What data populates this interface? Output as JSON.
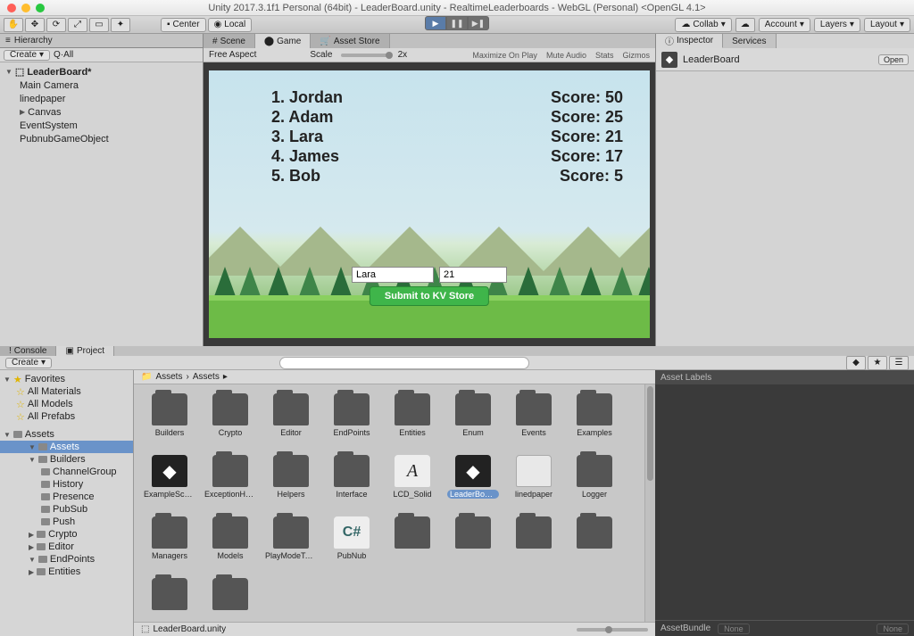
{
  "window": {
    "title": "Unity 2017.3.1f1 Personal (64bit) - LeaderBoard.unity - RealtimeLeaderboards - WebGL (Personal) <OpenGL 4.1>"
  },
  "toolbar": {
    "center": "Center",
    "local": "Local",
    "collab": "Collab",
    "account": "Account",
    "layers": "Layers",
    "layout": "Layout"
  },
  "hierarchy": {
    "tab": "Hierarchy",
    "create": "Create",
    "all_filter": "Q·All",
    "scene_name": "LeaderBoard*",
    "items": [
      "Main Camera",
      "linedpaper",
      "Canvas",
      "EventSystem",
      "PubnubGameObject"
    ]
  },
  "center_tabs": {
    "scene": "Scene",
    "game": "Game",
    "asset_store": "Asset Store"
  },
  "game_bar": {
    "aspect": "Free Aspect",
    "scale_label": "Scale",
    "scale_value": "2x",
    "opts": [
      "Maximize On Play",
      "Mute Audio",
      "Stats",
      "Gizmos"
    ]
  },
  "leaderboard": {
    "rows": [
      {
        "rank": "1.",
        "name": "Jordan",
        "score_label": "Score:",
        "score": "50"
      },
      {
        "rank": "2.",
        "name": "Adam",
        "score_label": "Score:",
        "score": "25"
      },
      {
        "rank": "3.",
        "name": "Lara",
        "score_label": "Score:",
        "score": "21"
      },
      {
        "rank": "4.",
        "name": "James",
        "score_label": "Score:",
        "score": "17"
      },
      {
        "rank": "5.",
        "name": "Bob",
        "score_label": "Score:",
        "score": "5"
      }
    ],
    "input_name": "Lara",
    "input_score": "21",
    "submit": "Submit to KV Store"
  },
  "inspector": {
    "tab_inspector": "Inspector",
    "tab_services": "Services",
    "obj_name": "LeaderBoard",
    "open": "Open",
    "asset_labels": "Asset Labels",
    "assetbundle": "AssetBundle",
    "none1": "None",
    "none2": "None"
  },
  "project": {
    "tab_console": "Console",
    "tab_project": "Project",
    "create": "Create",
    "crumb_root": "Assets",
    "crumb_sep": "›",
    "crumb_cur": "Assets",
    "footer": "LeaderBoard.unity",
    "tree": {
      "favorites": "Favorites",
      "fav_items": [
        "All Materials",
        "All Models",
        "All Prefabs"
      ],
      "assets": "Assets",
      "assets_children": [
        {
          "name": "Assets",
          "sel": true
        },
        {
          "name": "Builders"
        },
        {
          "name": "ChannelGroup",
          "ind": 3
        },
        {
          "name": "History",
          "ind": 3
        },
        {
          "name": "Presence",
          "ind": 3
        },
        {
          "name": "PubSub",
          "ind": 3
        },
        {
          "name": "Push",
          "ind": 3
        },
        {
          "name": "Crypto"
        },
        {
          "name": "Editor"
        },
        {
          "name": "EndPoints"
        },
        {
          "name": "Entities"
        }
      ]
    },
    "assets_row1": [
      "Builders",
      "Crypto",
      "Editor",
      "EndPoints",
      "Entities",
      "Enum",
      "Events",
      "Examples",
      "ExampleScene",
      "ExceptionHa..."
    ],
    "assets_row2": [
      {
        "n": "Helpers",
        "t": "folder"
      },
      {
        "n": "Interface",
        "t": "folder"
      },
      {
        "n": "LCD_Solid",
        "t": "font"
      },
      {
        "n": "LeaderBoard",
        "t": "scene",
        "sel": true
      },
      {
        "n": "linedpaper",
        "t": "file"
      },
      {
        "n": "Logger",
        "t": "folder"
      },
      {
        "n": "Managers",
        "t": "folder"
      },
      {
        "n": "Models",
        "t": "folder"
      },
      {
        "n": "PlayModeTes...",
        "t": "folder"
      },
      {
        "n": "PubNub",
        "t": "csharp"
      }
    ]
  }
}
